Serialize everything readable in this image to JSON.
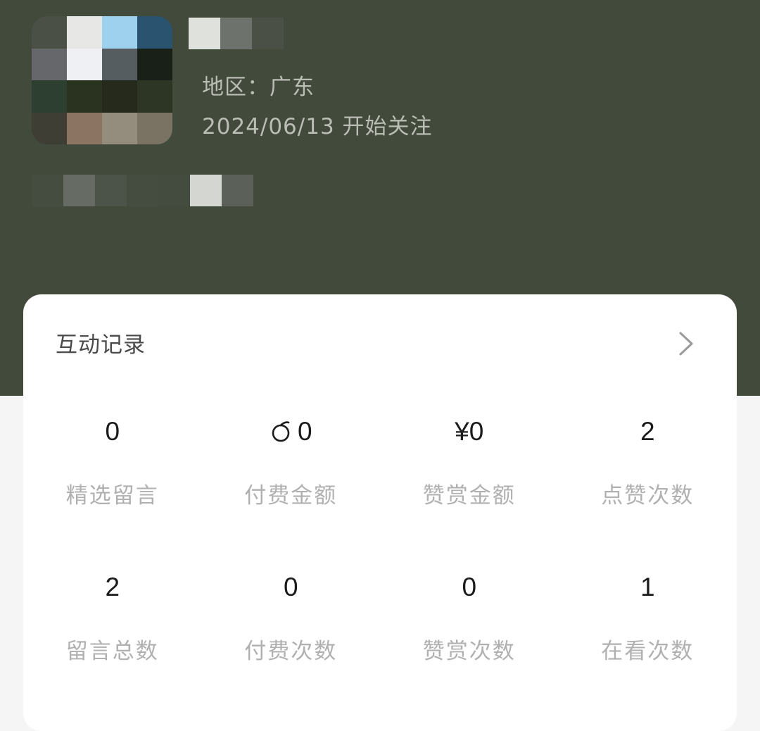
{
  "profile": {
    "region_label": "地区：广东",
    "follow_date": "2024/06/13 开始关注"
  },
  "card": {
    "title": "互动记录",
    "more_icon": "chevron-right-icon",
    "stats": [
      {
        "value": "0",
        "label": "精选留言"
      },
      {
        "value": "0",
        "label": "付费金额",
        "icon": "coin-icon"
      },
      {
        "value": "¥0",
        "label": "赞赏金额"
      },
      {
        "value": "2",
        "label": "点赞次数"
      },
      {
        "value": "2",
        "label": "留言总数"
      },
      {
        "value": "0",
        "label": "付费次数"
      },
      {
        "value": "0",
        "label": "赞赏次数"
      },
      {
        "value": "1",
        "label": "在看次数"
      }
    ]
  },
  "colors": {
    "header_bg": "#424a3c",
    "meta_text": "#b9bdb3",
    "label_text": "#b0b0b0"
  }
}
